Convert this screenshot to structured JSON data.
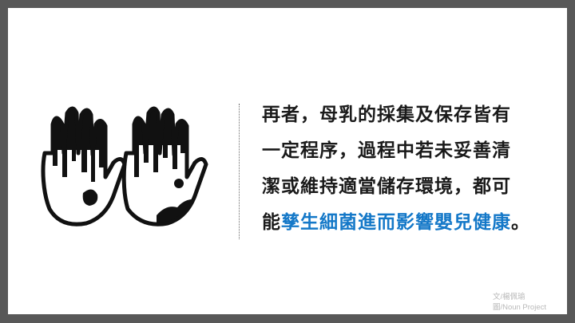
{
  "body": {
    "line1": "再者，母乳的採集及保存皆有",
    "line2": "一定程序，過程中若未妥善清",
    "line3": "潔或維持適當儲存環境，都可",
    "line4_plain": "能",
    "line4_highlight": "孳生細菌進而影響嬰兒健康",
    "line4_end": "。"
  },
  "credit": {
    "author": "文/楊佩瑜",
    "image": "圖/Noun Project"
  },
  "colors": {
    "highlight": "#1478c8",
    "frame": "#585858",
    "text": "#1a1a1a"
  },
  "icons": [
    "dirty-hand-left-icon",
    "dirty-hand-right-icon"
  ]
}
